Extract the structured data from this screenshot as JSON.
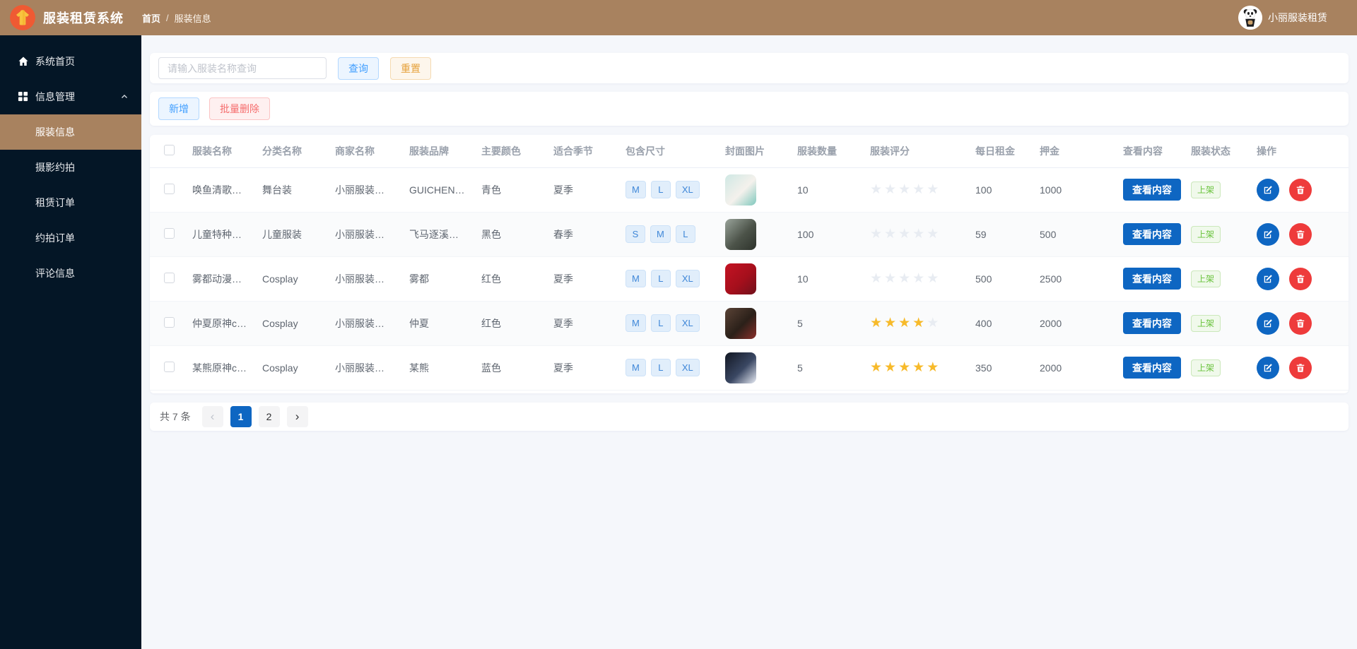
{
  "header": {
    "app_title": "服装租赁系统",
    "breadcrumb_home": "首页",
    "breadcrumb_separator": "/",
    "breadcrumb_current": "服装信息",
    "user_name": "小丽服装租赁"
  },
  "sidebar": {
    "items": [
      {
        "label": "系统首页",
        "icon": "home-icon"
      },
      {
        "label": "信息管理",
        "icon": "grid-icon",
        "expanded": true
      },
      {
        "label": "服装信息",
        "active": true
      },
      {
        "label": "摄影约拍"
      },
      {
        "label": "租赁订单"
      },
      {
        "label": "约拍订单"
      },
      {
        "label": "评论信息"
      }
    ]
  },
  "search": {
    "placeholder": "请输入服装名称查询",
    "query_label": "查询",
    "reset_label": "重置"
  },
  "toolbar": {
    "add_label": "新增",
    "batch_delete_label": "批量删除"
  },
  "table": {
    "columns": [
      "服装名称",
      "分类名称",
      "商家名称",
      "服装品牌",
      "主要颜色",
      "适合季节",
      "包含尺寸",
      "封面图片",
      "服装数量",
      "服装评分",
      "每日租金",
      "押金",
      "查看内容",
      "服装状态",
      "操作"
    ],
    "view_button_label": "查看内容",
    "rows": [
      {
        "name": "唤鱼清歌…",
        "category": "舞台装",
        "merchant": "小丽服装…",
        "brand": "GUICHEN…",
        "color": "青色",
        "season": "夏季",
        "sizes": [
          "M",
          "L",
          "XL"
        ],
        "cover_colors": [
          "#cfe8e4",
          "#f4f1ec",
          "#7fc8bd"
        ],
        "quantity": "10",
        "rating": 0,
        "daily_rent": "100",
        "deposit": "1000",
        "status": "上架"
      },
      {
        "name": "儿童特种…",
        "category": "儿童服装",
        "merchant": "小丽服装…",
        "brand": "飞马逐溪…",
        "color": "黑色",
        "season": "春季",
        "sizes": [
          "S",
          "M",
          "L"
        ],
        "cover_colors": [
          "#9aa49b",
          "#4c5349",
          "#2e332c"
        ],
        "quantity": "100",
        "rating": 0,
        "daily_rent": "59",
        "deposit": "500",
        "status": "上架"
      },
      {
        "name": "雾都动漫…",
        "category": "Cosplay",
        "merchant": "小丽服装…",
        "brand": "雾都",
        "color": "红色",
        "season": "夏季",
        "sizes": [
          "M",
          "L",
          "XL"
        ],
        "cover_colors": [
          "#c41323",
          "#a50f1c",
          "#70101b"
        ],
        "quantity": "10",
        "rating": 0,
        "daily_rent": "500",
        "deposit": "2500",
        "status": "上架"
      },
      {
        "name": "仲夏原神c…",
        "category": "Cosplay",
        "merchant": "小丽服装…",
        "brand": "仲夏",
        "color": "红色",
        "season": "夏季",
        "sizes": [
          "M",
          "L",
          "XL"
        ],
        "cover_colors": [
          "#5a4336",
          "#2b2019",
          "#8a2f2a"
        ],
        "quantity": "5",
        "rating": 4,
        "daily_rent": "400",
        "deposit": "2000",
        "status": "上架"
      },
      {
        "name": "某熊原神c…",
        "category": "Cosplay",
        "merchant": "小丽服装…",
        "brand": "某熊",
        "color": "蓝色",
        "season": "夏季",
        "sizes": [
          "M",
          "L",
          "XL"
        ],
        "cover_colors": [
          "#121722",
          "#3a4763",
          "#e8ecf5"
        ],
        "quantity": "5",
        "rating": 5,
        "daily_rent": "350",
        "deposit": "2000",
        "status": "上架"
      }
    ]
  },
  "pagination": {
    "total_label": "共 7 条",
    "prev_label": "‹",
    "next_label": "›",
    "pages": [
      "1",
      "2"
    ],
    "active_page": "1"
  },
  "colors": {
    "brand_brown": "#a8825f",
    "sidebar_dark": "#041626",
    "primary_blue": "#0e66c2",
    "soft_blue": "#409eff",
    "warning_orange": "#e6a23c",
    "danger_soft": "#f56c6c",
    "danger_strong": "#ee3b3b",
    "success_green": "#67c23a",
    "star_filled": "#f7ba2a",
    "star_empty": "#e8ecf2"
  }
}
